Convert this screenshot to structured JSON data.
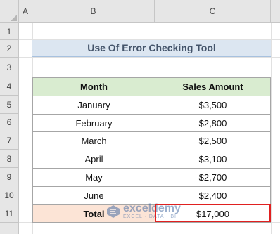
{
  "columns": [
    "A",
    "B",
    "C"
  ],
  "rows": [
    "1",
    "2",
    "3",
    "4",
    "5",
    "6",
    "7",
    "8",
    "9",
    "10",
    "11"
  ],
  "title": "Use Of Error Checking Tool",
  "table": {
    "headers": [
      "Month",
      "Sales Amount"
    ],
    "rows": [
      {
        "month": "January",
        "amount": "$3,500"
      },
      {
        "month": "February",
        "amount": "$2,800"
      },
      {
        "month": "March",
        "amount": "$2,500"
      },
      {
        "month": "April",
        "amount": "$3,100"
      },
      {
        "month": "May",
        "amount": "$2,700"
      },
      {
        "month": "June",
        "amount": "$2,400"
      }
    ],
    "total_label": "Total",
    "total_value": "$17,000"
  },
  "watermark": {
    "name": "exceldemy",
    "tagline": "EXCEL · DATA · BI"
  },
  "colors": {
    "title_fill": "#dce6f1",
    "header_fill": "#d9ecd0",
    "total_fill": "#fce4d6",
    "highlight_border": "#e02020"
  }
}
